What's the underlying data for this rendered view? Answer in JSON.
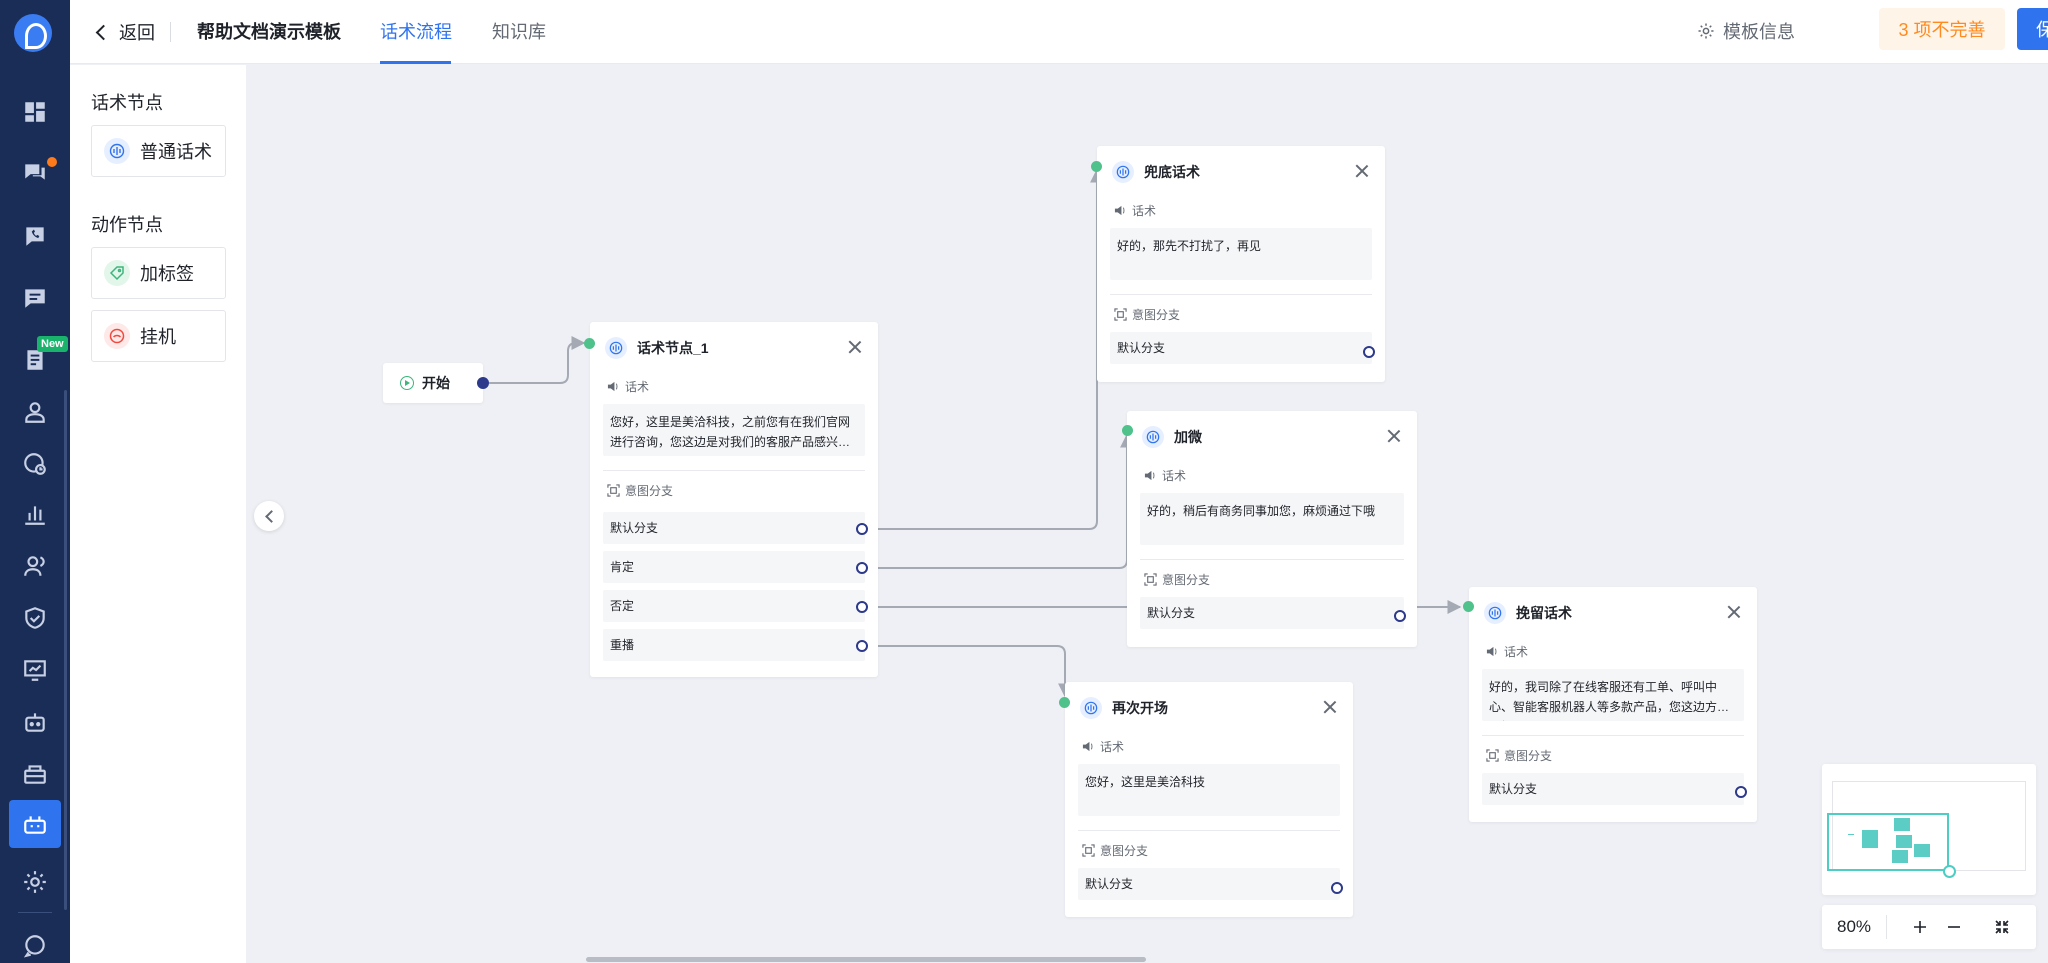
{
  "header": {
    "back_label": "返回",
    "template_title": "帮助文档演示模板",
    "tabs": [
      {
        "label": "话术流程",
        "active": true
      },
      {
        "label": "知识库",
        "active": false
      }
    ],
    "template_info_label": "模板信息",
    "incomplete_label": "3 项不完善",
    "save_label": "保存"
  },
  "rail": {
    "items": [
      {
        "icon": "dashboard-icon"
      },
      {
        "icon": "chat-bubbles-icon",
        "badge": "dot"
      },
      {
        "icon": "phone-chat-icon"
      },
      {
        "icon": "message-icon"
      },
      {
        "icon": "document-icon",
        "badge": "New"
      },
      {
        "icon": "user-icon"
      },
      {
        "icon": "globe-clock-icon"
      },
      {
        "icon": "bar-chart-icon"
      },
      {
        "icon": "team-icon"
      },
      {
        "icon": "shield-icon"
      },
      {
        "icon": "monitor-chart-icon"
      },
      {
        "icon": "robot-icon"
      },
      {
        "icon": "robot-box-icon"
      },
      {
        "icon": "robot-flow-icon",
        "active": true
      },
      {
        "icon": "gear-icon"
      },
      {
        "icon": "support-chat-icon"
      }
    ]
  },
  "palette": {
    "script_section": "话术节点",
    "script_items": [
      {
        "label": "普通话术",
        "icon": "script-icon"
      }
    ],
    "action_section": "动作节点",
    "action_items": [
      {
        "label": "加标签",
        "icon": "tag-icon"
      },
      {
        "label": "挂机",
        "icon": "hangup-icon"
      }
    ]
  },
  "canvas": {
    "start": {
      "label": "开始"
    },
    "section_script": "话术",
    "section_intent": "意图分支",
    "nodes": {
      "n1": {
        "title": "话术节点_1",
        "script": "您好，这里是美洽科技，之前您有在我们官网进行咨询，您这边是对我们的客服产品感兴趣吗？",
        "branches": [
          "默认分支",
          "肯定",
          "否定",
          "重播"
        ]
      },
      "fallback": {
        "title": "兜底话术",
        "script": "好的，那先不打扰了，再见",
        "branches": [
          "默认分支"
        ]
      },
      "wechat": {
        "title": "加微",
        "script": "好的，稍后有商务同事加您，麻烦通过下哦",
        "branches": [
          "默认分支"
        ]
      },
      "retain": {
        "title": "挽留话术",
        "script": "好的，我司除了在线客服还有工单、呼叫中心、智能客服机器人等多款产品，您这边方便了解一下吗？",
        "branches": [
          "默认分支"
        ]
      },
      "reopen": {
        "title": "再次开场",
        "script": "您好，这里是美洽科技",
        "branches": [
          "默认分支"
        ]
      }
    }
  },
  "zoom": {
    "value": "80%"
  },
  "colors": {
    "primary": "#2f74ee",
    "rail_bg": "#1a2d57",
    "warning": "#ff8a1f",
    "port_in": "#4fc28b",
    "port_out": "#2d3a8c",
    "minimap": "#4ecdc4"
  }
}
